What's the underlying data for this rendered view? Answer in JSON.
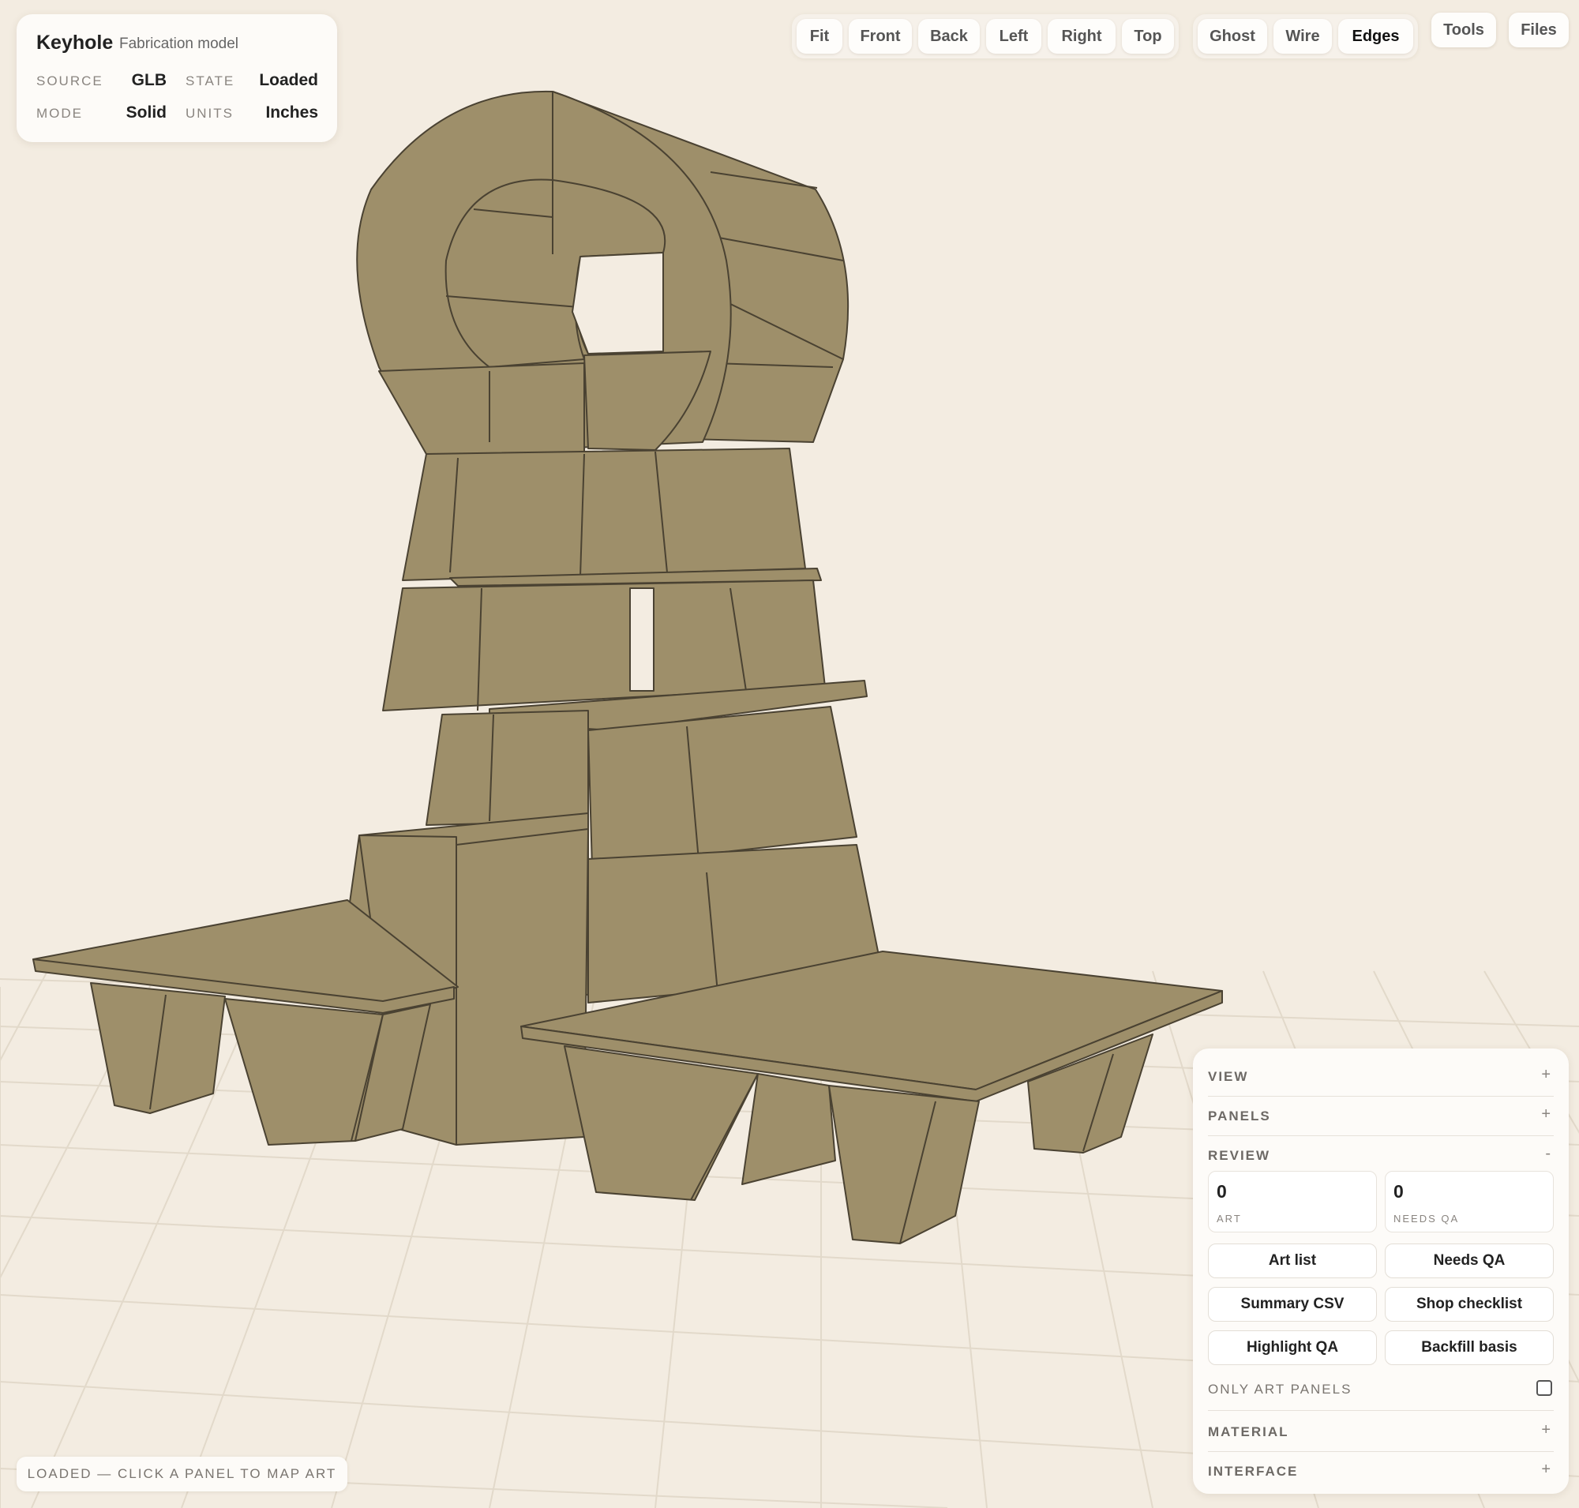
{
  "info": {
    "title": "Keyhole",
    "subtitle": "Fabrication model",
    "source_label": "SOURCE",
    "source_value": "GLB",
    "state_label": "STATE",
    "state_value": "Loaded",
    "mode_label": "MODE",
    "mode_value": "Solid",
    "units_label": "UNITS",
    "units_value": "Inches"
  },
  "toolbar": {
    "views": [
      "Fit",
      "Front",
      "Back",
      "Left",
      "Right",
      "Top"
    ],
    "render_modes": [
      "Ghost",
      "Wire",
      "Edges"
    ],
    "active_render_mode": "Edges",
    "tools_label": "Tools",
    "files_label": "Files"
  },
  "status": "LOADED — CLICK A PANEL TO MAP ART",
  "side_panel": {
    "sections": {
      "view": {
        "label": "VIEW",
        "toggle": "+"
      },
      "panels": {
        "label": "PANELS",
        "toggle": "+"
      },
      "review": {
        "label": "REVIEW",
        "toggle": "-"
      },
      "material": {
        "label": "MATERIAL",
        "toggle": "+"
      },
      "interface": {
        "label": "INTERFACE",
        "toggle": "+"
      }
    },
    "review": {
      "art_count": "0",
      "art_label": "ART",
      "needs_qa_count": "0",
      "needs_qa_label": "NEEDS QA",
      "buttons": [
        "Art list",
        "Needs QA",
        "Summary CSV",
        "Shop checklist",
        "Highlight QA",
        "Backfill basis"
      ],
      "only_art_label": "ONLY ART PANELS",
      "only_art_checked": false
    }
  },
  "colors": {
    "background": "#f3ece1",
    "panel_face": "#9e8f6a",
    "panel_edge": "#4a4232",
    "grid": "#e4dccd"
  }
}
